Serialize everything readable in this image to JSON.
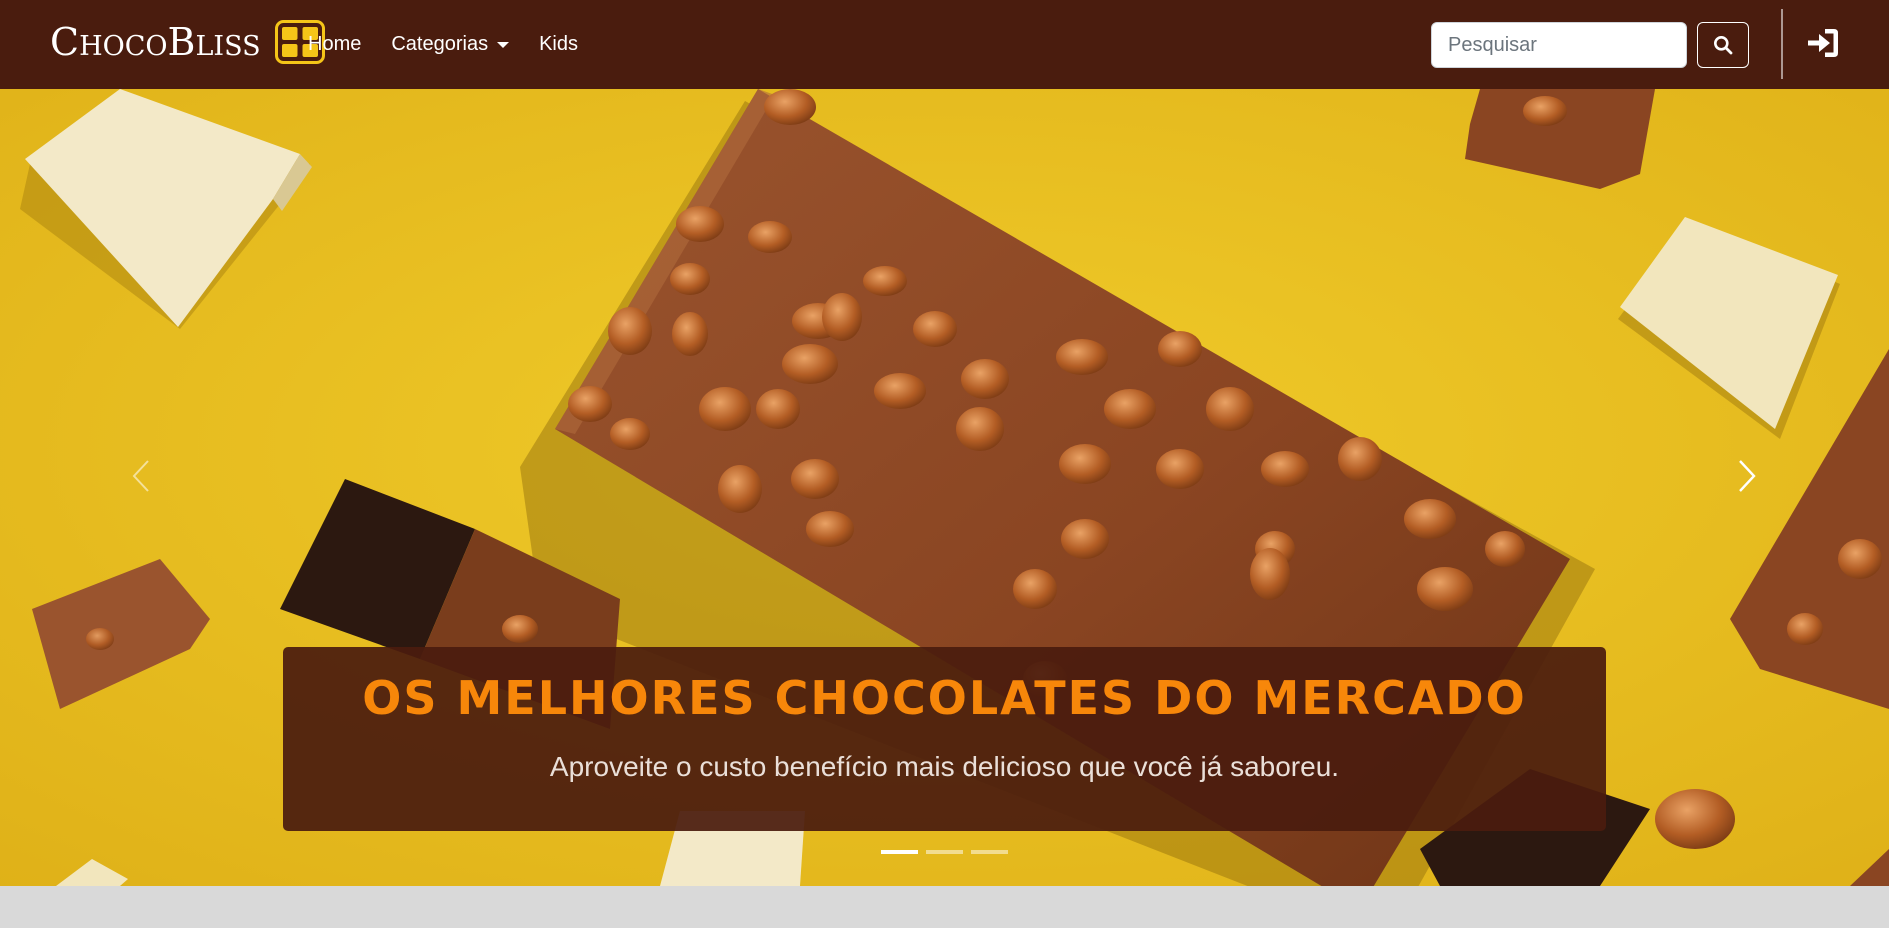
{
  "navbar": {
    "brand": "ChocoBliss",
    "links": [
      {
        "label": "Home"
      },
      {
        "label": "Categorias"
      },
      {
        "label": "Kids"
      }
    ],
    "search": {
      "placeholder": "Pesquisar",
      "value": ""
    },
    "icons": {
      "logo": "grid-logo-icon",
      "search": "search-icon",
      "login": "sign-in-icon"
    }
  },
  "carousel": {
    "slide_title": "OS MELHORES CHOCOLATES DO MERCADO",
    "slide_text": "Aproveite o custo benefício mais delicioso que você já saboreu.",
    "slide_count": 3,
    "active_slide": 1,
    "controls": {
      "prev": "chevron-left-icon",
      "next": "chevron-right-icon"
    }
  },
  "colors": {
    "navbar_bg": "#4a1c0e",
    "accent": "#f7870a",
    "logo_yellow": "#f5c518",
    "hero_bg": "#ebc321"
  }
}
